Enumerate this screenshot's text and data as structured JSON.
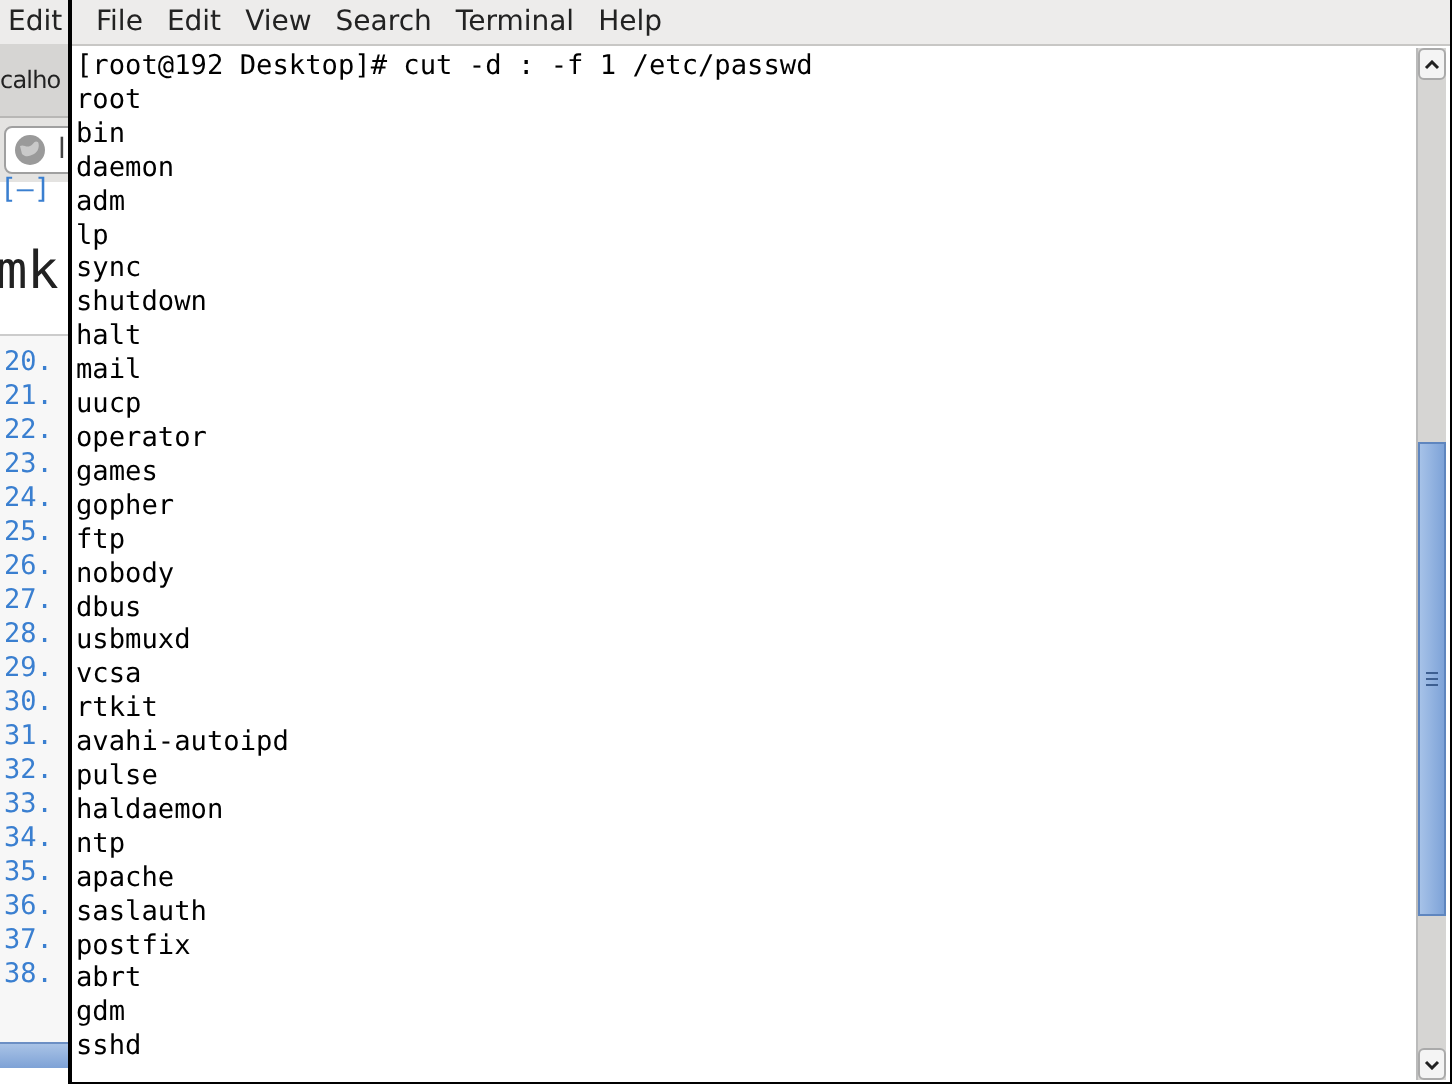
{
  "background_window": {
    "menu": [
      "Edit"
    ],
    "tab": {
      "label": "calho"
    },
    "address_field": {
      "value": "l"
    },
    "link": "[–]",
    "heading": "mk",
    "line_numbers": [
      "20.",
      "21.",
      "22.",
      "23.",
      "24.",
      "25.",
      "26.",
      "27.",
      "28.",
      "29.",
      "30.",
      "31.",
      "32.",
      "33.",
      "34.",
      "35.",
      "36.",
      "37.",
      "38."
    ]
  },
  "terminal": {
    "menu": [
      "File",
      "Edit",
      "View",
      "Search",
      "Terminal",
      "Help"
    ],
    "lines": [
      "[root@192 Desktop]# cut -d : -f 1 /etc/passwd",
      "root",
      "bin",
      "daemon",
      "adm",
      "lp",
      "sync",
      "shutdown",
      "halt",
      "mail",
      "uucp",
      "operator",
      "games",
      "gopher",
      "ftp",
      "nobody",
      "dbus",
      "usbmuxd",
      "vcsa",
      "rtkit",
      "avahi-autoipd",
      "pulse",
      "haldaemon",
      "ntp",
      "apache",
      "saslauth",
      "postfix",
      "abrt",
      "gdm",
      "sshd"
    ]
  }
}
